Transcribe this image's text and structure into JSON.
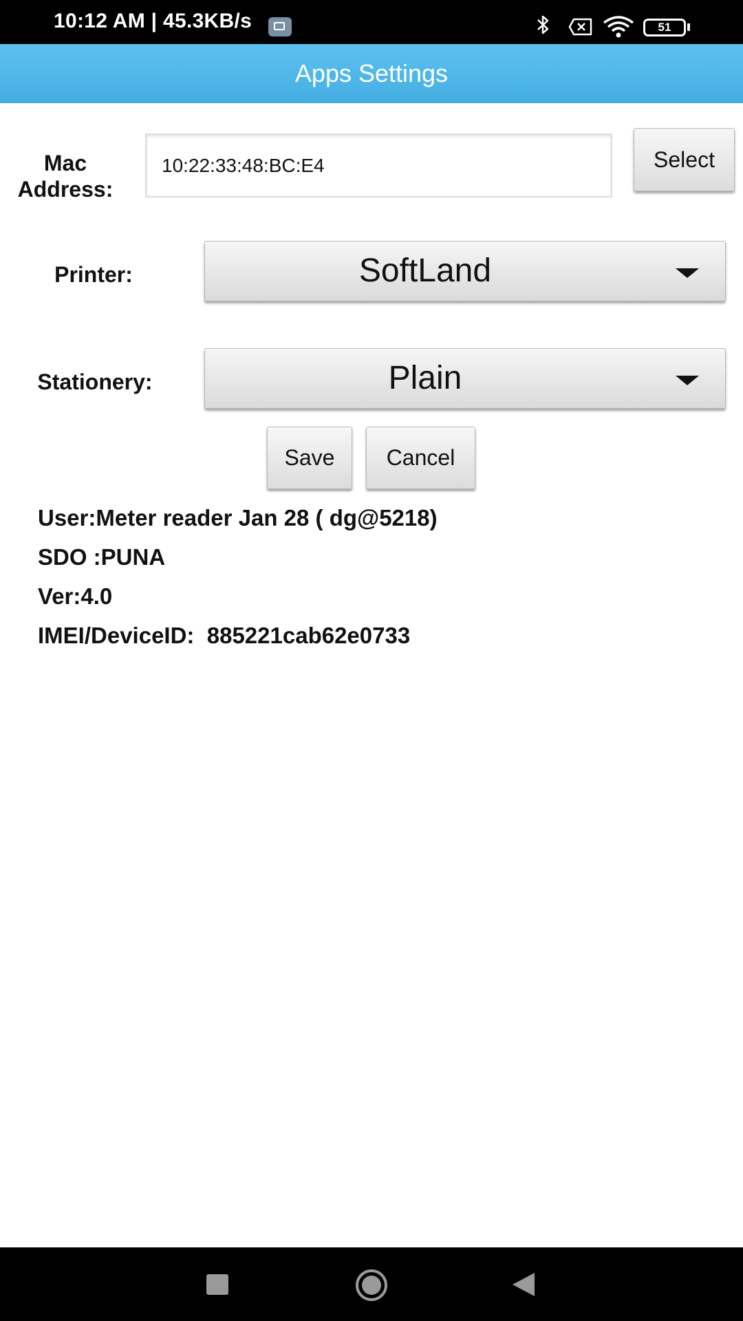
{
  "status_bar": {
    "time_speed": "10:12 AM | 45.3KB/s",
    "battery": "51",
    "icons": [
      "gallery-icon",
      "bluetooth-icon",
      "no-sim-icon",
      "wifi-icon",
      "battery-icon"
    ]
  },
  "header": {
    "title": "Apps Settings"
  },
  "form": {
    "mac_label_line1": "Mac",
    "mac_label_line2": "Address:",
    "mac_value": "10:22:33:48:BC:E4",
    "select_label": "Select",
    "printer_label": "Printer:",
    "printer_value": "SoftLand",
    "stationery_label": "Stationery:",
    "stationery_value": "Plain",
    "save_label": "Save",
    "cancel_label": "Cancel"
  },
  "info": {
    "user": "User:Meter reader Jan 28 ( dg@5218)",
    "sdo": "SDO :PUNA",
    "version": "Ver:4.0",
    "imei": "IMEI/DeviceID:  885221cab62e0733"
  },
  "nav": {
    "icons": [
      "recents-icon",
      "home-icon",
      "back-icon"
    ]
  },
  "colors": {
    "header": "#4db6e8",
    "status_bar": "#000000",
    "nav_bar": "#000000"
  }
}
